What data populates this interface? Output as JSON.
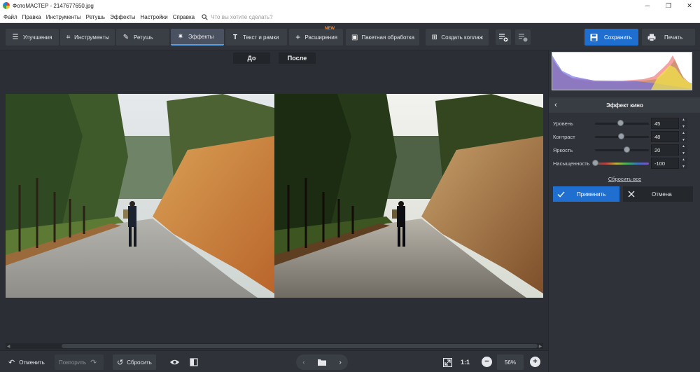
{
  "window": {
    "title": "ФотоМАСТЕР - 2147677650.jpg"
  },
  "menu": {
    "items": [
      "Файл",
      "Правка",
      "Инструменты",
      "Ретушь",
      "Эффекты",
      "Настройки",
      "Справка"
    ],
    "search_placeholder": "Что вы хотите сделать?"
  },
  "toolbar": {
    "tabs": [
      {
        "label": "Улучшения"
      },
      {
        "label": "Инструменты"
      },
      {
        "label": "Ретушь"
      },
      {
        "label": "Эффекты"
      },
      {
        "label": "Текст и рамки"
      },
      {
        "label": "Расширения",
        "badge": "NEW"
      },
      {
        "label": "Пакетная обработка"
      },
      {
        "label": "Создать коллаж"
      }
    ],
    "save_label": "Сохранить",
    "print_label": "Печать"
  },
  "canvas": {
    "before_label": "До",
    "after_label": "После"
  },
  "bottom": {
    "undo_label": "Отменить",
    "redo_label": "Повторить",
    "reset_label": "Сбросить",
    "zoom_fit_label": "1:1",
    "zoom_value": "56%"
  },
  "panel": {
    "title": "Эффект кино",
    "params": [
      {
        "label": "Уровень",
        "value": "45",
        "position": 0.45
      },
      {
        "label": "Контраст",
        "value": "48",
        "position": 0.48
      },
      {
        "label": "Яркость",
        "value": "20",
        "position": 0.6
      },
      {
        "label": "Насыщенность",
        "value": "-100",
        "position": 0.0
      }
    ],
    "reset_all_label": "Сбросить все",
    "apply_label": "Применить",
    "cancel_label": "Отмена"
  },
  "colors": {
    "accent": "#1f6fd1",
    "badge": "#ff8a2a",
    "bg": "#2b2e34"
  }
}
